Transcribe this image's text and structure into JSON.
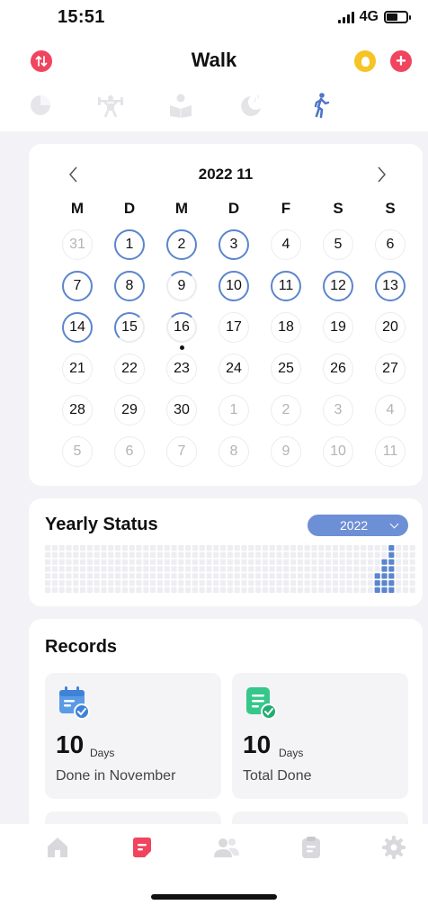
{
  "status_bar": {
    "time": "15:51",
    "network": "4G"
  },
  "header": {
    "title": "Walk",
    "sort_button_icon": "sort-arrows-icon",
    "tip_button_icon": "lightbulb-icon",
    "add_button_icon": "plus-icon"
  },
  "category_tabs": [
    {
      "icon": "pie-chart-icon",
      "active": false
    },
    {
      "icon": "weightlifting-icon",
      "active": false
    },
    {
      "icon": "reading-icon",
      "active": false
    },
    {
      "icon": "sleep-moon-icon",
      "active": false
    },
    {
      "icon": "walking-icon",
      "active": true
    }
  ],
  "calendar": {
    "month_label": "2022 11",
    "weekdays": [
      "M",
      "D",
      "M",
      "D",
      "F",
      "S",
      "S"
    ],
    "weeks": [
      [
        "31",
        "1",
        "2",
        "3",
        "4",
        "5",
        "6"
      ],
      [
        "7",
        "8",
        "9",
        "10",
        "11",
        "12",
        "13"
      ],
      [
        "14",
        "15",
        "16",
        "17",
        "18",
        "19",
        "20"
      ],
      [
        "21",
        "22",
        "23",
        "24",
        "25",
        "26",
        "27"
      ],
      [
        "28",
        "29",
        "30",
        "1",
        "2",
        "3",
        "4"
      ],
      [
        "5",
        "6",
        "7",
        "8",
        "9",
        "10",
        "11"
      ]
    ],
    "today": "16"
  },
  "yearly_status": {
    "title": "Yearly Status",
    "year": "2022"
  },
  "records": {
    "title": "Records",
    "tiles": [
      {
        "value": "10",
        "unit": "Days",
        "label": "Done in November",
        "icon": "calendar-check-icon",
        "color": "#5b9be6"
      },
      {
        "value": "10",
        "unit": "Days",
        "label": "Total Done",
        "icon": "note-check-icon",
        "color": "#36c78b"
      }
    ]
  },
  "tab_bar": [
    {
      "icon": "home-icon",
      "active": false
    },
    {
      "icon": "habit-note-icon",
      "active": true
    },
    {
      "icon": "friends-icon",
      "active": false
    },
    {
      "icon": "clipboard-icon",
      "active": false
    },
    {
      "icon": "gear-icon",
      "active": false
    }
  ],
  "colors": {
    "accent_red": "#f0445f",
    "accent_blue": "#5b85ce",
    "accent_yellow": "#f7c325",
    "accent_green": "#36c78b"
  }
}
